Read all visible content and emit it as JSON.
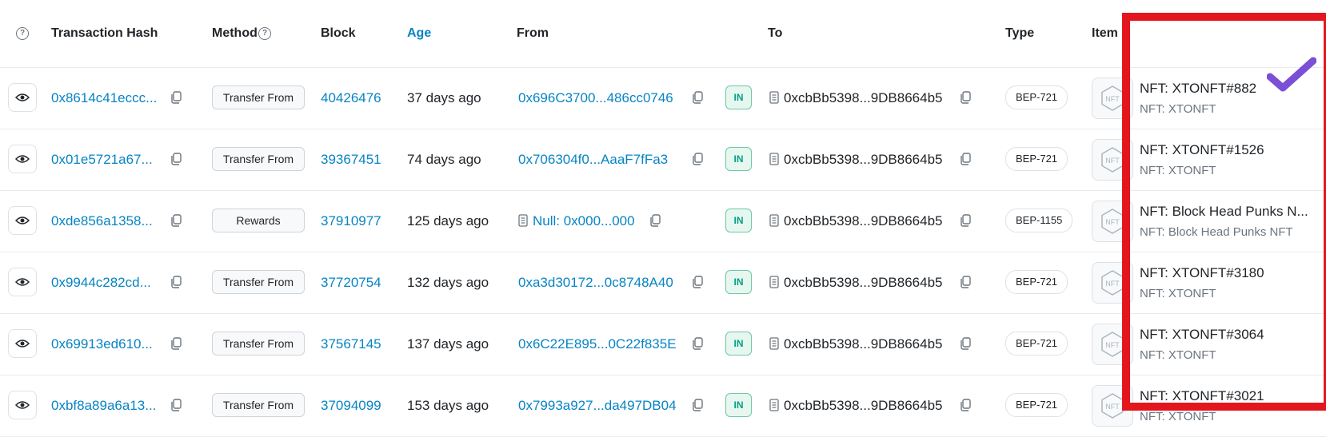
{
  "header": {
    "transaction_hash": "Transaction Hash",
    "method": "Method",
    "block": "Block",
    "age": "Age",
    "from": "From",
    "to": "To",
    "type": "Type",
    "item": "Item"
  },
  "colors": {
    "link": "#0784c3",
    "in_badge": "#00a186",
    "highlight": "#e3161d",
    "checkmark": "#7b4fd6"
  },
  "icons": {
    "help": "question-circle-icon",
    "eye": "eye-icon",
    "copy": "copy-icon",
    "contract": "document-icon",
    "nft": "nft-hexagon-icon",
    "check": "checkmark-icon"
  },
  "rows": [
    {
      "hash": "0x8614c41eccc...",
      "method": "Transfer From",
      "block": "40426476",
      "age": "37 days ago",
      "from": "0x696C3700...486cc0746",
      "from_contract": false,
      "direction": "IN",
      "to": "0xcbBb5398...9DB8664b5",
      "type": "BEP-721",
      "item_name": "NFT: XTONFT#882",
      "item_collection": "NFT: XTONFT"
    },
    {
      "hash": "0x01e5721a67...",
      "method": "Transfer From",
      "block": "39367451",
      "age": "74 days ago",
      "from": "0x706304f0...AaaF7fFa3",
      "from_contract": false,
      "direction": "IN",
      "to": "0xcbBb5398...9DB8664b5",
      "type": "BEP-721",
      "item_name": "NFT: XTONFT#1526",
      "item_collection": "NFT: XTONFT"
    },
    {
      "hash": "0xde856a1358...",
      "method": "Rewards",
      "block": "37910977",
      "age": "125 days ago",
      "from": "Null: 0x000...000",
      "from_contract": true,
      "direction": "IN",
      "to": "0xcbBb5398...9DB8664b5",
      "type": "BEP-1155",
      "item_name": "NFT: Block Head Punks N...",
      "item_collection": "NFT: Block Head Punks NFT"
    },
    {
      "hash": "0x9944c282cd...",
      "method": "Transfer From",
      "block": "37720754",
      "age": "132 days ago",
      "from": "0xa3d30172...0c8748A40",
      "from_contract": false,
      "direction": "IN",
      "to": "0xcbBb5398...9DB8664b5",
      "type": "BEP-721",
      "item_name": "NFT: XTONFT#3180",
      "item_collection": "NFT: XTONFT"
    },
    {
      "hash": "0x69913ed610...",
      "method": "Transfer From",
      "block": "37567145",
      "age": "137 days ago",
      "from": "0x6C22E895...0C22f835E",
      "from_contract": false,
      "direction": "IN",
      "to": "0xcbBb5398...9DB8664b5",
      "type": "BEP-721",
      "item_name": "NFT: XTONFT#3064",
      "item_collection": "NFT: XTONFT"
    },
    {
      "hash": "0xbf8a89a6a13...",
      "method": "Transfer From",
      "block": "37094099",
      "age": "153 days ago",
      "from": "0x7993a927...da497DB04",
      "from_contract": false,
      "direction": "IN",
      "to": "0xcbBb5398...9DB8664b5",
      "type": "BEP-721",
      "item_name": "NFT: XTONFT#3021",
      "item_collection": "NFT: XTONFT"
    }
  ]
}
